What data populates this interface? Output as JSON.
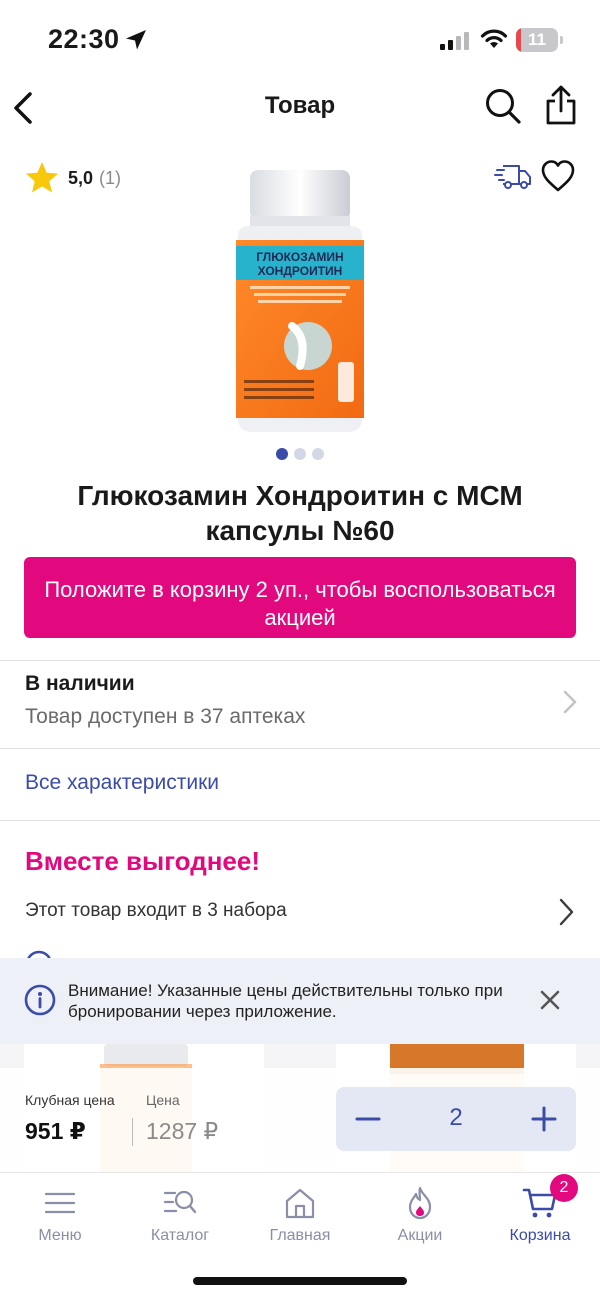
{
  "status_bar": {
    "time": "22:30",
    "battery_level": "11",
    "battery_fraction": 0.11
  },
  "header": {
    "title": "Товар"
  },
  "rating": {
    "value": "5,0",
    "count": "(1)"
  },
  "carousel": {
    "pages": 3,
    "active_index": 0
  },
  "product": {
    "title": "Глюкозамин Хондроитин с МСМ капсулы №60",
    "image_label_line1": "ГЛЮКОЗАМИН",
    "image_label_line2": "ХОНДРОИТИН"
  },
  "promo": {
    "label": "Положите в корзину 2 уп., чтобы воспользоваться акцией"
  },
  "availability": {
    "title": "В наличии",
    "subtitle": "Товар доступен в 37 аптеках"
  },
  "specs": {
    "link_label": "Все характеристики"
  },
  "bundles": {
    "title": "Вместе выгоднее!",
    "description": "Этот товар входит в 3 набора"
  },
  "notice": {
    "text": "Внимание! Указанные цены действительны только при бронировании через приложение."
  },
  "price": {
    "club_label": "Клубная цена",
    "club_value": "951 ₽",
    "regular_label": "Цена",
    "regular_value": "1287 ₽"
  },
  "quantity": {
    "value": "2"
  },
  "tabs": [
    {
      "label": "Меню",
      "icon": "menu-icon"
    },
    {
      "label": "Каталог",
      "icon": "catalog-icon"
    },
    {
      "label": "Главная",
      "icon": "home-icon"
    },
    {
      "label": "Акции",
      "icon": "promo-icon"
    },
    {
      "label": "Корзина",
      "icon": "cart-icon"
    }
  ],
  "cart_badge": "2",
  "colors": {
    "brand_magenta": "#e2097f",
    "brand_blue": "#3a4ba8",
    "stepper_bg": "#e4e8f5",
    "notice_bg": "#eef0f7"
  }
}
